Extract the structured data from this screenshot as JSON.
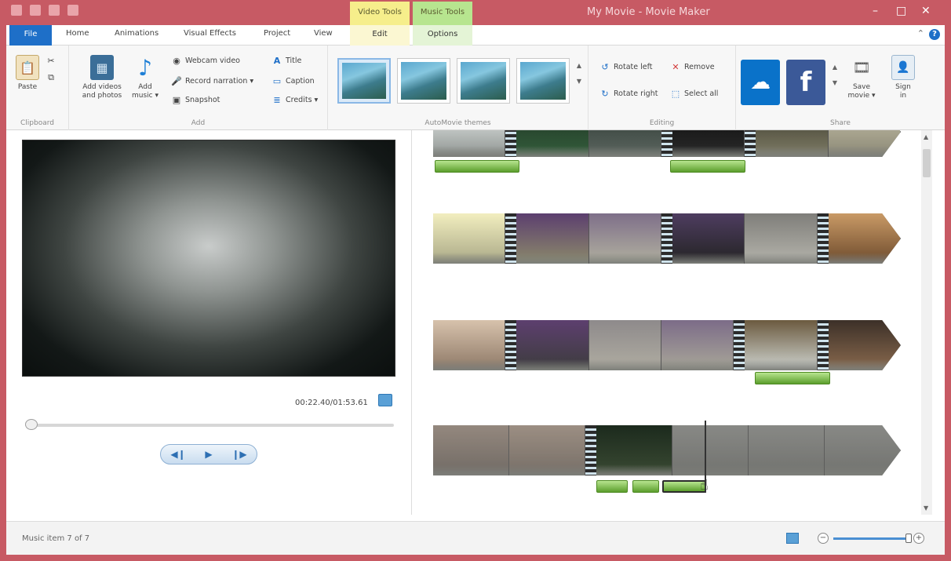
{
  "window": {
    "title": "My Movie - Movie Maker",
    "minimize": "–",
    "maximize": "□",
    "close": "✕"
  },
  "context_tabs": {
    "video_tools": "Video Tools",
    "music_tools": "Music Tools",
    "edit": "Edit",
    "options": "Options"
  },
  "tabs": [
    "File",
    "Home",
    "Animations",
    "Visual Effects",
    "Project",
    "View"
  ],
  "ribbon": {
    "clipboard": {
      "label": "Clipboard",
      "paste": "Paste"
    },
    "add": {
      "label": "Add",
      "add_videos_line1": "Add videos",
      "add_videos_line2": "and photos",
      "add_music_line1": "Add",
      "add_music_line2": "music ▾",
      "webcam": "Webcam video",
      "narration": "Record narration ▾",
      "snapshot": "Snapshot",
      "title": "Title",
      "caption": "Caption",
      "credits": "Credits ▾"
    },
    "themes": {
      "label": "AutoMovie themes"
    },
    "editing": {
      "label": "Editing",
      "rotate_left": "Rotate left",
      "rotate_right": "Rotate right",
      "remove": "Remove",
      "select_all": "Select all"
    },
    "share": {
      "label": "Share",
      "save_line1": "Save",
      "save_line2": "movie ▾",
      "sign_line1": "Sign",
      "sign_line2": "in"
    }
  },
  "preview": {
    "timecode": "00:22.40/01:53.61"
  },
  "status": {
    "text": "Music item 7 of 7"
  },
  "colors": {
    "title_bar": "#c75a64",
    "file_tab": "#1e6fc8",
    "video_tools": "#f6ee8b",
    "music_tools": "#b7e58f",
    "audio_clip": "#6fb43a"
  }
}
